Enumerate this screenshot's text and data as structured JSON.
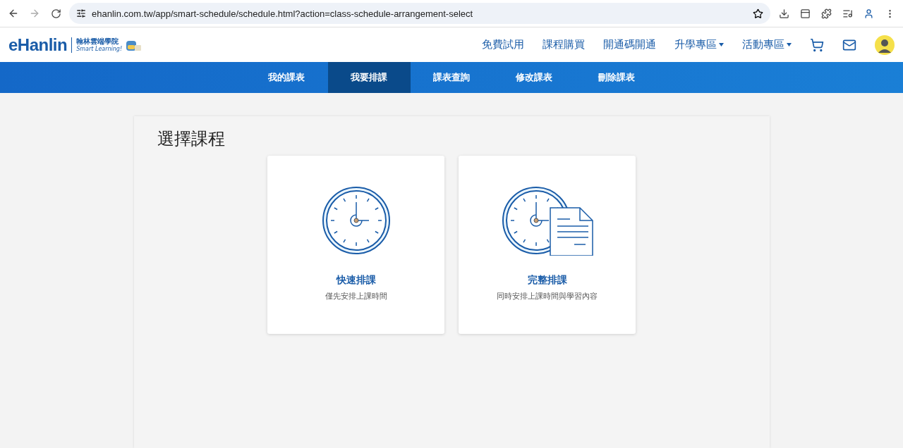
{
  "browser": {
    "url": "ehanlin.com.tw/app/smart-schedule/schedule.html?action=class-schedule-arrangement-select"
  },
  "header": {
    "logo": "eHanlin",
    "brand_name": "翰林雲端學院",
    "brand_tagline": "Smart Learning!",
    "menu": [
      {
        "label": "免費試用",
        "dropdown": false
      },
      {
        "label": "課程購買",
        "dropdown": false
      },
      {
        "label": "開通碼開通",
        "dropdown": false
      },
      {
        "label": "升學專區",
        "dropdown": true
      },
      {
        "label": "活動專區",
        "dropdown": true
      }
    ]
  },
  "nav": [
    {
      "label": "我的課表",
      "selected": false
    },
    {
      "label": "我要排課",
      "selected": true
    },
    {
      "label": "課表查詢",
      "selected": false
    },
    {
      "label": "修改課表",
      "selected": false
    },
    {
      "label": "刪除課表",
      "selected": false
    }
  ],
  "panel": {
    "title": "選擇課程",
    "cards": [
      {
        "kind": "clock",
        "title": "快速排課",
        "subtitle": "僅先安排上課時間"
      },
      {
        "kind": "clock-document",
        "title": "完整排課",
        "subtitle": "同時安排上課時間與學習內容"
      }
    ]
  }
}
